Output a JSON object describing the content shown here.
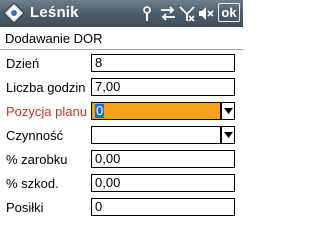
{
  "titlebar": {
    "app_title": "Leśnik",
    "ok_label": "ok",
    "icons": [
      "signal-icon",
      "sync-arrows-icon",
      "no-signal-icon",
      "speaker-icon"
    ],
    "bg_color": "#4f5f6b"
  },
  "form": {
    "title": "Dodawanie DOR",
    "fields": [
      {
        "label": "Dzień",
        "value": "8"
      },
      {
        "label": "Liczba godzin",
        "value": "7,00"
      },
      {
        "label": "Pozycja planu",
        "value": "0"
      },
      {
        "label": "Czynność",
        "value": ""
      },
      {
        "label": "% zarobku",
        "value": "0,00"
      },
      {
        "label": "% szkod.",
        "value": "0,00"
      },
      {
        "label": "Posiłki",
        "value": "0"
      }
    ],
    "highlight_color": "#f5a31a",
    "required_label_color": "#c0392b"
  }
}
